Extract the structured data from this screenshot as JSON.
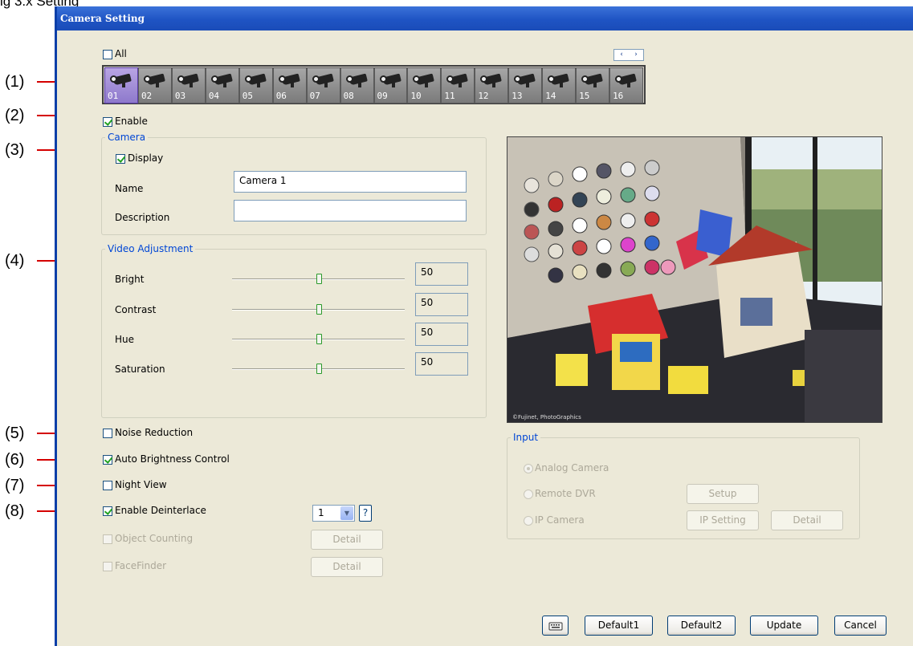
{
  "doc_header_fragment": "ig 3.x Setting",
  "callouts": [
    "(1)",
    "(2)",
    "(3)",
    "(4)",
    "(5)",
    "(6)",
    "(7)",
    "(8)"
  ],
  "window": {
    "title": "Camera Setting",
    "title_bar_color": "#1f54c4"
  },
  "all_checkbox": {
    "label": "All",
    "checked": false
  },
  "camera_strip": {
    "selected": "01",
    "cameras": [
      "01",
      "02",
      "03",
      "04",
      "05",
      "06",
      "07",
      "08",
      "09",
      "10",
      "11",
      "12",
      "13",
      "14",
      "15",
      "16"
    ],
    "nav_prev_icon": "‹",
    "nav_next_icon": "›"
  },
  "enable": {
    "label": "Enable",
    "checked": true
  },
  "camera_group": {
    "title": "Camera",
    "display_label": "Display",
    "display_checked": true,
    "name_label": "Name",
    "name_value": "Camera 1",
    "description_label": "Description",
    "description_value": ""
  },
  "video_adjustment": {
    "title": "Video Adjustment",
    "items": [
      {
        "label": "Bright",
        "value": "50"
      },
      {
        "label": "Contrast",
        "value": "50"
      },
      {
        "label": "Hue",
        "value": "50"
      },
      {
        "label": "Saturation",
        "value": "50"
      }
    ],
    "slider_fraction": 0.5
  },
  "options": {
    "noise_reduction": {
      "label": "Noise Reduction",
      "checked": false
    },
    "auto_brightness": {
      "label": "Auto Brightness Control",
      "checked": true
    },
    "night_view": {
      "label": "Night View",
      "checked": false
    },
    "deinterlace": {
      "label": "Enable Deinterlace",
      "checked": true,
      "value": "1",
      "help": "?"
    },
    "object_counting": {
      "label": "Object Counting",
      "checked": false,
      "detail": "Detail"
    },
    "face_finder": {
      "label": "FaceFinder",
      "checked": false,
      "detail": "Detail"
    }
  },
  "input_group": {
    "title": "Input",
    "analog": "Analog Camera",
    "remote_dvr": "Remote DVR",
    "setup": "Setup",
    "ip_camera": "IP Camera",
    "ip_setting": "IP Setting",
    "detail": "Detail",
    "selected": "analog"
  },
  "preview": {
    "caption": "©Fujinet, PhotoGraphics"
  },
  "bottom_buttons": {
    "keyboard_icon": "keyboard-icon",
    "default1": "Default1",
    "default2": "Default2",
    "update": "Update",
    "cancel": "Cancel"
  },
  "colors": {
    "accent": "#0046d5",
    "callout_line": "#d40000",
    "window_bg": "#ece9d8"
  }
}
